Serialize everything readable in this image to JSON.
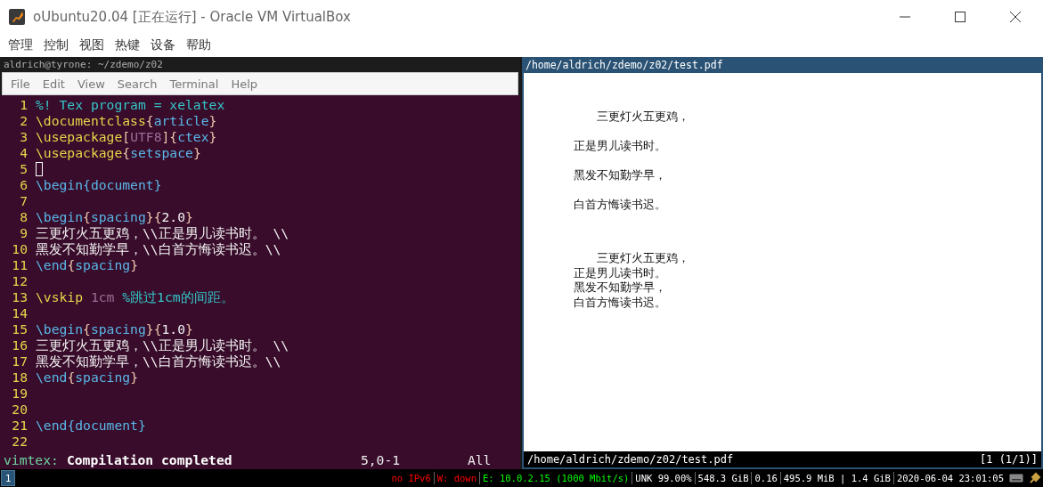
{
  "window": {
    "title": "oUbuntu20.04 [正在运行] - Oracle VM VirtualBox"
  },
  "menu": [
    "管理",
    "控制",
    "视图",
    "热键",
    "设备",
    "帮助"
  ],
  "terminal": {
    "title": "aldrich@tyrone: ~/zdemo/z02",
    "menu": [
      "File",
      "Edit",
      "View",
      "Search",
      "Terminal",
      "Help"
    ],
    "lines": [
      {
        "number": "1",
        "cursor": false,
        "segments": [
          {
            "kind": "comment",
            "text": "%! Tex program = xelatex"
          }
        ]
      },
      {
        "number": "2",
        "cursor": false,
        "segments": [
          {
            "kind": "cmd",
            "text": "\\documentclass"
          },
          {
            "kind": "brace",
            "text": "{"
          },
          {
            "kind": "arg",
            "text": "article"
          },
          {
            "kind": "brace",
            "text": "}"
          }
        ]
      },
      {
        "number": "3",
        "cursor": false,
        "segments": [
          {
            "kind": "cmd",
            "text": "\\usepackage"
          },
          {
            "kind": "brace",
            "text": "["
          },
          {
            "kind": "option",
            "text": "UTF8"
          },
          {
            "kind": "brace",
            "text": "]{"
          },
          {
            "kind": "arg",
            "text": "ctex"
          },
          {
            "kind": "brace",
            "text": "}"
          }
        ]
      },
      {
        "number": "4",
        "cursor": false,
        "segments": [
          {
            "kind": "cmd",
            "text": "\\usepackage"
          },
          {
            "kind": "brace",
            "text": "{"
          },
          {
            "kind": "arg",
            "text": "setspace"
          },
          {
            "kind": "brace",
            "text": "}"
          }
        ]
      },
      {
        "number": "5",
        "cursor": true
      },
      {
        "number": "6",
        "cursor": false,
        "segments": [
          {
            "kind": "env",
            "text": "\\begin"
          },
          {
            "kind": "arg",
            "text": "{document}"
          }
        ]
      },
      {
        "number": "7",
        "cursor": false
      },
      {
        "number": "8",
        "cursor": false,
        "segments": [
          {
            "kind": "env",
            "text": "\\begin"
          },
          {
            "kind": "brace",
            "text": "{"
          },
          {
            "kind": "arg",
            "text": "spacing"
          },
          {
            "kind": "brace",
            "text": "}{"
          },
          {
            "kind": "text",
            "text": "2.0"
          },
          {
            "kind": "brace",
            "text": "}"
          }
        ]
      },
      {
        "number": "9",
        "cursor": false,
        "segments": [
          {
            "kind": "text",
            "text": "三更灯火五更鸡，\\\\正是男儿读书时。 \\\\"
          }
        ]
      },
      {
        "number": "10",
        "cursor": false,
        "segments": [
          {
            "kind": "text",
            "text": "黑发不知勤学早，\\\\白首方悔读书迟。\\\\"
          }
        ]
      },
      {
        "number": "11",
        "cursor": false,
        "segments": [
          {
            "kind": "env",
            "text": "\\end"
          },
          {
            "kind": "brace",
            "text": "{"
          },
          {
            "kind": "arg",
            "text": "spacing"
          },
          {
            "kind": "brace",
            "text": "}"
          }
        ]
      },
      {
        "number": "12",
        "cursor": false
      },
      {
        "number": "13",
        "cursor": false,
        "segments": [
          {
            "kind": "cmd",
            "text": "\\vskip"
          },
          {
            "kind": "option",
            "text": " 1cm"
          },
          {
            "kind": "comment",
            "text": " %跳过1cm的间距。"
          }
        ]
      },
      {
        "number": "14",
        "cursor": false
      },
      {
        "number": "15",
        "cursor": false,
        "segments": [
          {
            "kind": "env",
            "text": "\\begin"
          },
          {
            "kind": "brace",
            "text": "{"
          },
          {
            "kind": "arg",
            "text": "spacing"
          },
          {
            "kind": "brace",
            "text": "}{"
          },
          {
            "kind": "text",
            "text": "1.0"
          },
          {
            "kind": "brace",
            "text": "}"
          }
        ]
      },
      {
        "number": "16",
        "cursor": false,
        "segments": [
          {
            "kind": "text",
            "text": "三更灯火五更鸡，\\\\正是男儿读书时。 \\\\"
          }
        ]
      },
      {
        "number": "17",
        "cursor": false,
        "segments": [
          {
            "kind": "text",
            "text": "黑发不知勤学早，\\\\白首方悔读书迟。\\\\"
          }
        ]
      },
      {
        "number": "18",
        "cursor": false,
        "segments": [
          {
            "kind": "env",
            "text": "\\end"
          },
          {
            "kind": "brace",
            "text": "{"
          },
          {
            "kind": "arg",
            "text": "spacing"
          },
          {
            "kind": "brace",
            "text": "}"
          }
        ]
      },
      {
        "number": "19",
        "cursor": false
      },
      {
        "number": "20",
        "cursor": false
      },
      {
        "number": "21",
        "cursor": false,
        "segments": [
          {
            "kind": "env",
            "text": "\\end"
          },
          {
            "kind": "arg",
            "text": "{document}"
          }
        ]
      },
      {
        "number": "22",
        "cursor": false
      }
    ],
    "status": {
      "plugin": "vimtex:",
      "message": "Compilation completed",
      "position": "5,0-1",
      "scroll": "All"
    }
  },
  "pdf": {
    "title": "/home/aldrich/zdemo/z02/test.pdf",
    "blocks": [
      {
        "kind": "double",
        "lines": [
          "三更灯火五更鸡，",
          "正是男儿读书时。",
          "黑发不知勤学早，",
          "白首方悔读书迟。"
        ]
      },
      {
        "kind": "single",
        "lines": [
          "三更灯火五更鸡，",
          "正是男儿读书时。",
          "黑发不知勤学早，",
          "白首方悔读书迟。"
        ]
      }
    ],
    "footer_path": "/home/aldrich/zdemo/z02/test.pdf",
    "footer_page": "[1 (1/1)]"
  },
  "bar": {
    "workspace": "1",
    "items": [
      {
        "text": "no IPv6",
        "color": "#ff0000"
      },
      {
        "text": "W: down",
        "color": "#ff0000"
      },
      {
        "text": "E: 10.0.2.15 (1000 Mbit/s)",
        "color": "#00ff00"
      },
      {
        "text": "UNK 99.00%",
        "color": "#ffffff"
      },
      {
        "text": "548.3 GiB",
        "color": "#ffffff"
      },
      {
        "text": "0.16",
        "color": "#ffffff"
      },
      {
        "text": "495.9 MiB | 1.4 GiB",
        "color": "#ffffff"
      },
      {
        "text": "2020-06-04 23:01:05",
        "color": "#ffffff"
      }
    ]
  }
}
